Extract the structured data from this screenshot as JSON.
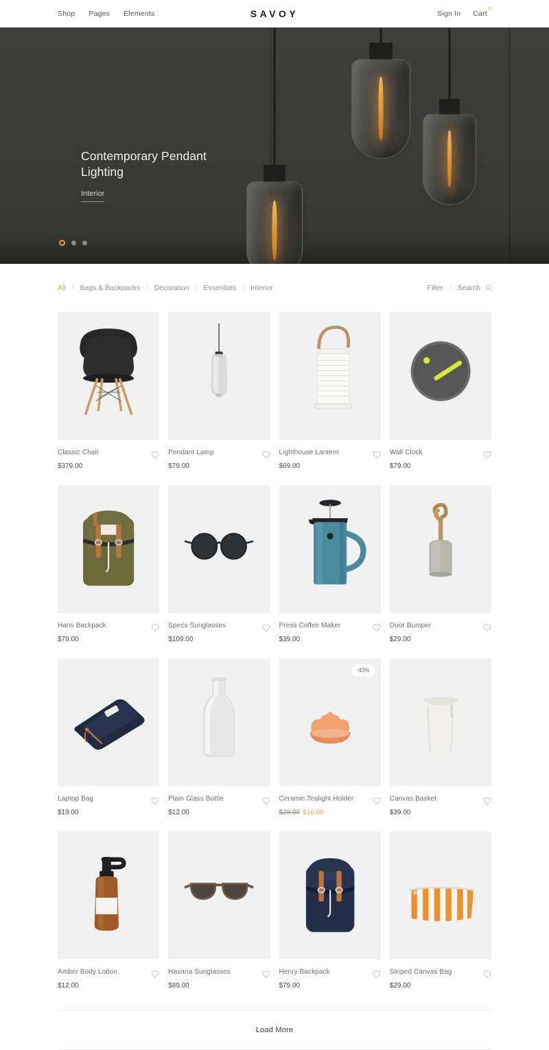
{
  "header": {
    "brand": "SAVOY",
    "nav_left": [
      {
        "label": "Shop"
      },
      {
        "label": "Pages"
      },
      {
        "label": "Elements"
      }
    ],
    "sign_in": "Sign In",
    "cart": "Cart",
    "cart_count": "0"
  },
  "hero": {
    "title": "Contemporary Pendant Lighting",
    "subtitle": "Interior",
    "slides": [
      {
        "active": true
      },
      {
        "active": false
      },
      {
        "active": false
      }
    ]
  },
  "filterbar": {
    "categories": [
      {
        "label": "All",
        "active": true
      },
      {
        "label": "Bags & Backpacks",
        "active": false
      },
      {
        "label": "Decoration",
        "active": false
      },
      {
        "label": "Essentials",
        "active": false
      },
      {
        "label": "Interior",
        "active": false
      }
    ],
    "separator": "/",
    "filter_label": "Filter",
    "search_label": "Search",
    "search_icon": "search-icon"
  },
  "products": [
    {
      "name": "Classic Chair",
      "price": "$379.00",
      "art": "chair",
      "favorite_icon": "heart-icon"
    },
    {
      "name": "Pendant Lamp",
      "price": "$79.00",
      "art": "pendant",
      "favorite_icon": "heart-icon"
    },
    {
      "name": "Lighthouse Lantern",
      "price": "$69.00",
      "art": "lantern",
      "favorite_icon": "heart-icon"
    },
    {
      "name": "Wall Clock",
      "price": "$79.00",
      "art": "clock",
      "favorite_icon": "heart-icon"
    },
    {
      "name": "Hans Backpack",
      "price": "$79.00",
      "art": "backpack-olive",
      "favorite_icon": "heart-icon"
    },
    {
      "name": "Specs Sunglasses",
      "price": "$109.00",
      "art": "sunglasses-round",
      "favorite_icon": "heart-icon"
    },
    {
      "name": "Press Coffee Maker",
      "price": "$39.00",
      "art": "press",
      "favorite_icon": "heart-icon"
    },
    {
      "name": "Door Bumper",
      "price": "$29.00",
      "art": "bumper",
      "favorite_icon": "heart-icon"
    },
    {
      "name": "Laptop Bag",
      "price": "$19.00",
      "art": "laptop-bag",
      "favorite_icon": "heart-icon"
    },
    {
      "name": "Plain Glass Bottle",
      "price": "$12.00",
      "art": "bottle",
      "favorite_icon": "heart-icon"
    },
    {
      "name": "Ceramic Tealight Holder",
      "price_old": "$28.00",
      "price_new": "$16.00",
      "badge": "-43%",
      "art": "tealight",
      "favorite_icon": "heart-icon"
    },
    {
      "name": "Canvas Basket",
      "price": "$39.00",
      "art": "basket",
      "favorite_icon": "heart-icon"
    },
    {
      "name": "Amber Body Lotion",
      "price": "$12.00",
      "art": "lotion",
      "favorite_icon": "heart-icon"
    },
    {
      "name": "Havana Sunglasses",
      "price": "$89.00",
      "art": "sunglasses-square",
      "favorite_icon": "heart-icon"
    },
    {
      "name": "Henry Backpack",
      "price": "$79.00",
      "art": "backpack-navy",
      "favorite_icon": "heart-icon"
    },
    {
      "name": "Striped Canvas Bag",
      "price": "$29.00",
      "art": "striped-bag",
      "favorite_icon": "heart-icon"
    }
  ],
  "footer": {
    "load_more": "Load More"
  },
  "colors": {
    "accent": "#e8a33d",
    "hero_bg": "#3a3a38",
    "tile_bg": "#f1f1f1",
    "text": "#6f6f6f"
  }
}
